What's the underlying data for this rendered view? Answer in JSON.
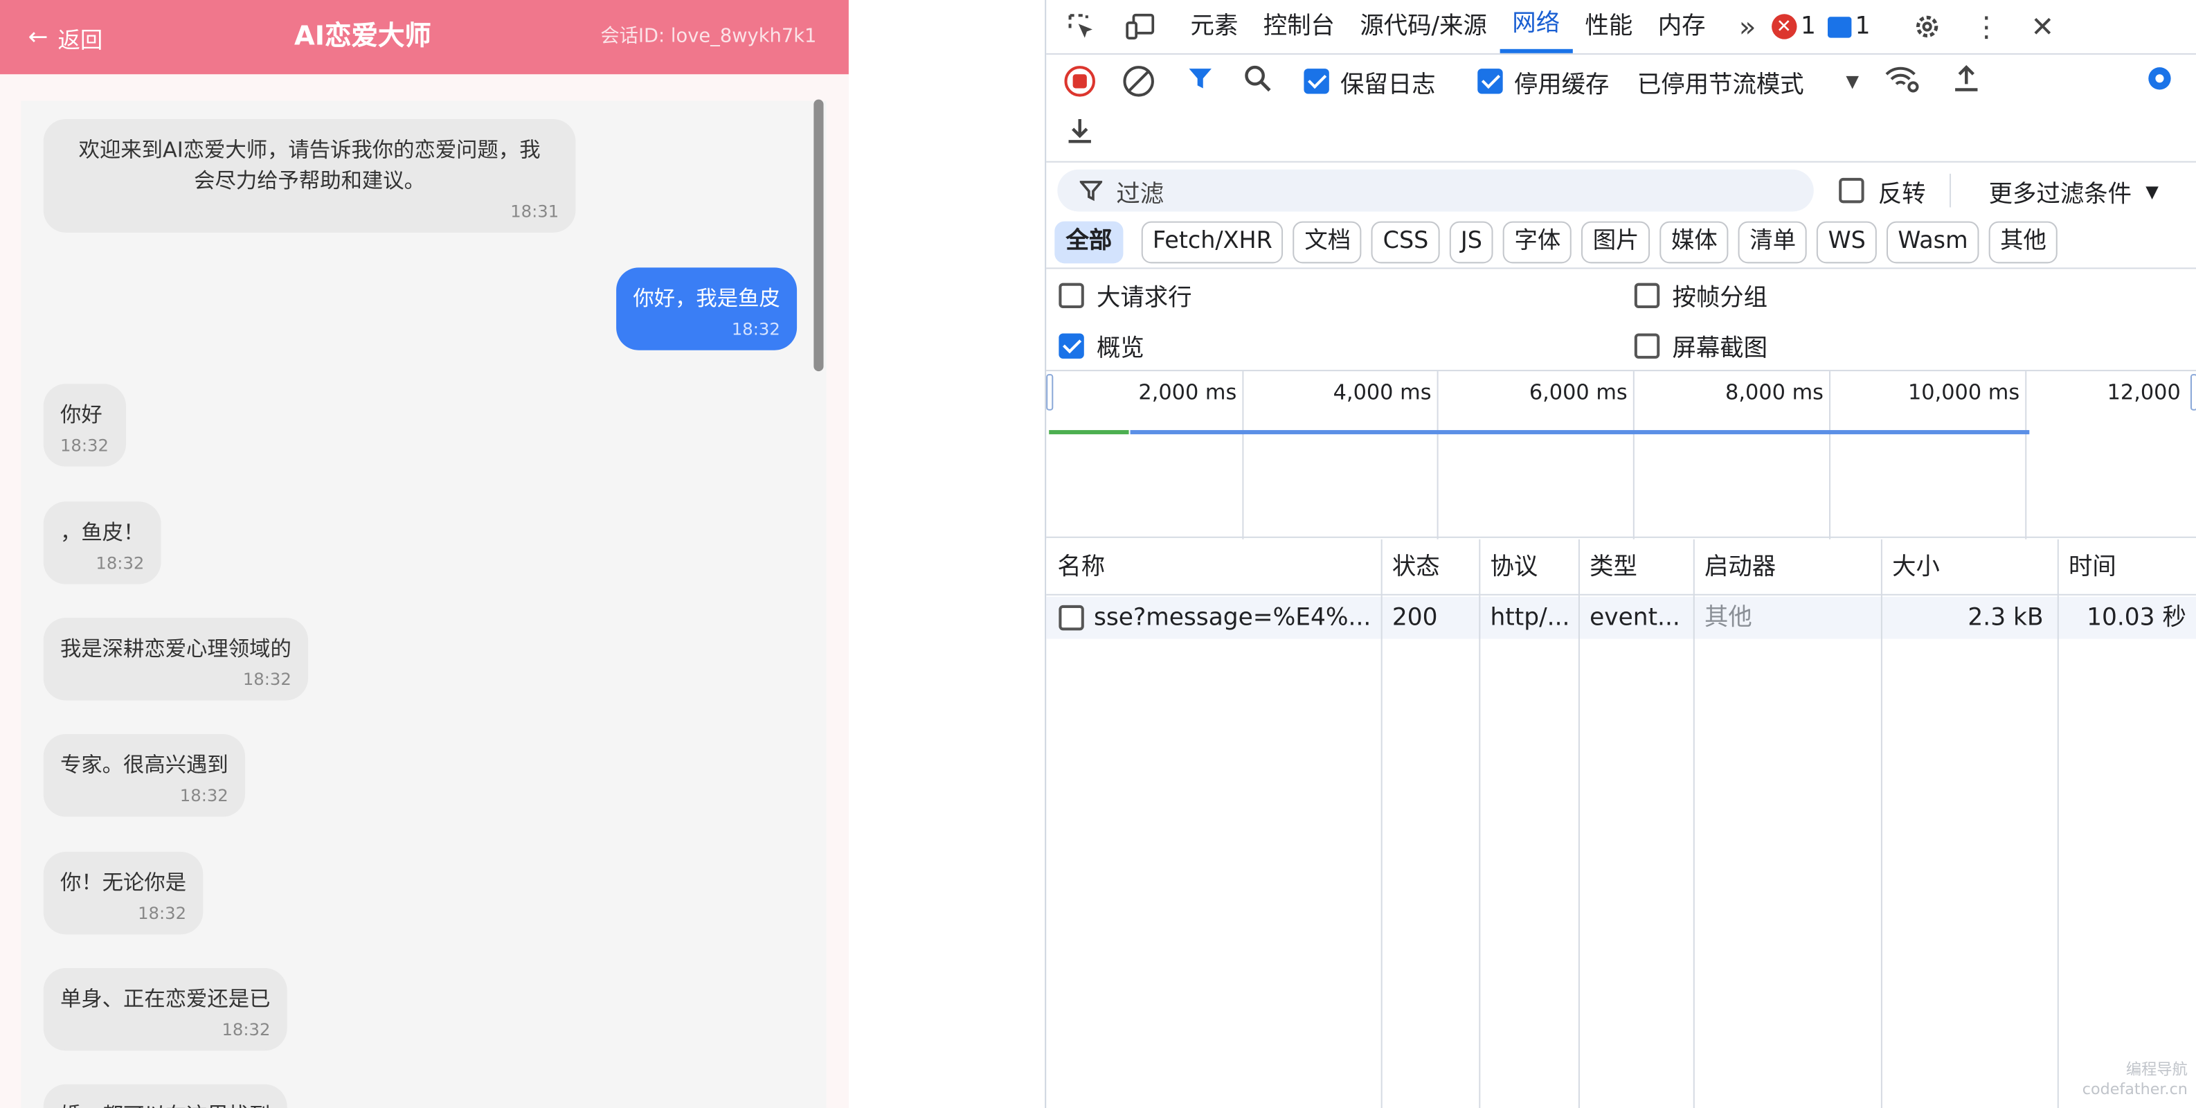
{
  "app": {
    "back_label": "返回",
    "title": "AI恋爱大师",
    "session_label": "会话ID: love_8wykh7k1",
    "messages": [
      {
        "role": "ai",
        "text": "欢迎来到AI恋爱大师，请告诉我你的恋爱问题，我\n会尽力给予帮助和建议。",
        "time": "18:31"
      },
      {
        "role": "user",
        "text": "你好，我是鱼皮",
        "time": "18:32"
      },
      {
        "role": "ai",
        "text": "你好",
        "time": "18:32"
      },
      {
        "role": "ai",
        "text": "，鱼皮！",
        "time": "18:32"
      },
      {
        "role": "ai",
        "text": "我是深耕恋爱心理领域的",
        "time": "18:32"
      },
      {
        "role": "ai",
        "text": "专家。很高兴遇到",
        "time": "18:32"
      },
      {
        "role": "ai",
        "text": "你！无论你是",
        "time": "18:32"
      },
      {
        "role": "ai",
        "text": "单身、正在恋爱还是已",
        "time": "18:32"
      },
      {
        "role": "ai",
        "text": "婚，都可以在这里找到",
        "time": ""
      }
    ]
  },
  "devtools": {
    "tabs": [
      "元素",
      "控制台",
      "源代码/来源",
      "网络",
      "性能",
      "内存"
    ],
    "active_tab": "网络",
    "error_count": "1",
    "message_count": "1",
    "preserve_log_label": "保留日志",
    "disable_cache_label": "停用缓存",
    "throttle_label": "已停用节流模式",
    "filter_placeholder": "过滤",
    "invert_label": "反转",
    "more_filters_label": "更多过滤条件",
    "type_filters": [
      "全部",
      "Fetch/XHR",
      "文档",
      "CSS",
      "JS",
      "字体",
      "图片",
      "媒体",
      "清单",
      "WS",
      "Wasm",
      "其他"
    ],
    "large_rows_label": "大请求行",
    "group_by_frame_label": "按帧分组",
    "overview_label": "概览",
    "screenshots_label": "屏幕截图",
    "timeline_ticks": [
      "2,000 ms",
      "4,000 ms",
      "6,000 ms",
      "8,000 ms",
      "10,000 ms",
      "12,000"
    ],
    "columns": [
      "名称",
      "状态",
      "协议",
      "类型",
      "启动器",
      "大小",
      "时间"
    ],
    "rows": [
      {
        "name": "sse?message=%E4%...",
        "status": "200",
        "protocol": "http/...",
        "type": "event...",
        "initiator": "其他",
        "size": "2.3 kB",
        "time": "10.03 秒"
      }
    ]
  },
  "watermark": {
    "line1": "编程导航",
    "line2": "codefather.cn"
  }
}
